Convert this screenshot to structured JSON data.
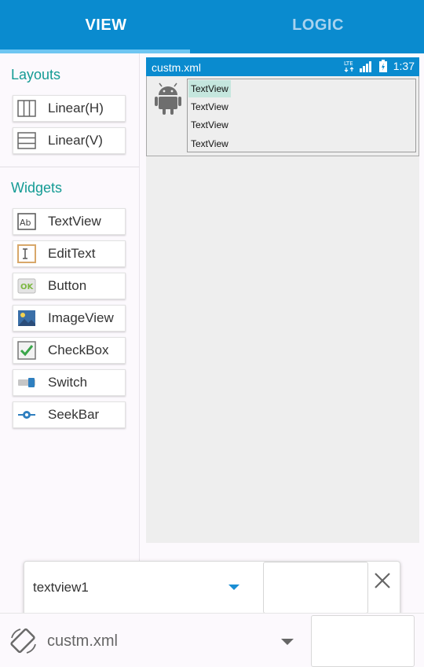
{
  "tabs": [
    {
      "label": "VIEW",
      "selected": true
    },
    {
      "label": "LOGIC",
      "selected": false
    }
  ],
  "palette": {
    "layouts_title": "Layouts",
    "layouts": [
      {
        "label": "Linear(H)",
        "icon": "linear-horizontal-icon"
      },
      {
        "label": "Linear(V)",
        "icon": "linear-vertical-icon"
      }
    ],
    "widgets_title": "Widgets",
    "widgets": [
      {
        "label": "TextView",
        "icon": "textview-icon"
      },
      {
        "label": "EditText",
        "icon": "edittext-icon"
      },
      {
        "label": "Button",
        "icon": "button-icon"
      },
      {
        "label": "ImageView",
        "icon": "imageview-icon"
      },
      {
        "label": "CheckBox",
        "icon": "checkbox-icon"
      },
      {
        "label": "Switch",
        "icon": "switch-icon"
      },
      {
        "label": "SeekBar",
        "icon": "seekbar-icon"
      }
    ]
  },
  "preview": {
    "file": "custm.xml",
    "status_time": "1:37",
    "status_network": "LTE",
    "items": [
      "TextView",
      "TextView",
      "TextView",
      "TextView"
    ],
    "selected_index": 0
  },
  "properties": {
    "selected_widget": "textview1"
  },
  "bottom": {
    "file": "custm.xml"
  },
  "colors": {
    "primary": "#0a8bcf",
    "accent": "#139b94",
    "tab_indicator": "#6ec6f2",
    "selected_item": "#c5e6de"
  }
}
